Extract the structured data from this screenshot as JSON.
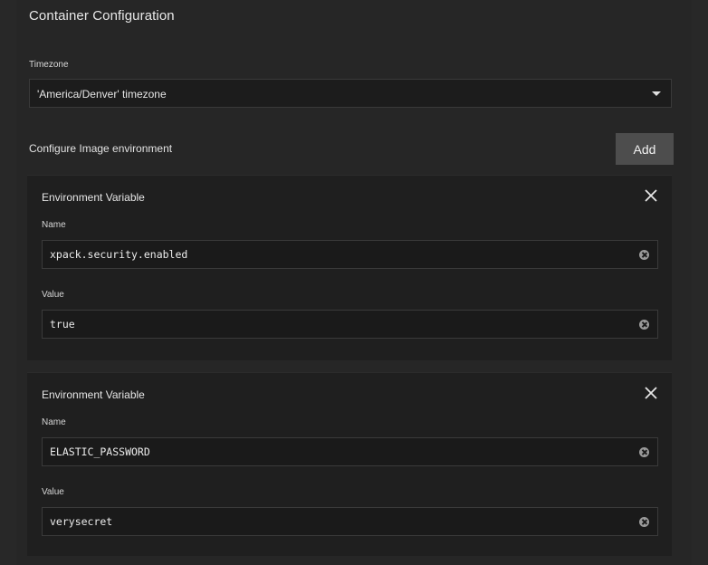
{
  "section": {
    "title": "Container Configuration"
  },
  "timezone": {
    "label": "Timezone",
    "selected": "'America/Denver' timezone"
  },
  "environment": {
    "label": "Configure Image environment",
    "add_label": "Add",
    "items": [
      {
        "title": "Environment Variable",
        "name_label": "Name",
        "name_value": "xpack.security.enabled",
        "value_label": "Value",
        "value_value": "true"
      },
      {
        "title": "Environment Variable",
        "name_label": "Name",
        "name_value": "ELASTIC_PASSWORD",
        "value_label": "Value",
        "value_value": "verysecret"
      }
    ]
  }
}
